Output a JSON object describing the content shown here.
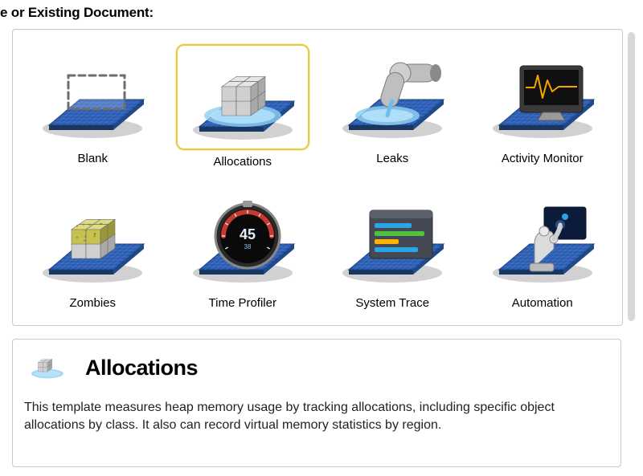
{
  "header": {
    "title_fragment": "e or Existing Document:"
  },
  "templates": [
    {
      "id": "blank",
      "label": "Blank",
      "selected": false,
      "icon": "blank"
    },
    {
      "id": "allocations",
      "label": "Allocations",
      "selected": true,
      "icon": "allocations"
    },
    {
      "id": "leaks",
      "label": "Leaks",
      "selected": false,
      "icon": "leaks"
    },
    {
      "id": "activity-monitor",
      "label": "Activity Monitor",
      "selected": false,
      "icon": "activity-monitor"
    },
    {
      "id": "zombies",
      "label": "Zombies",
      "selected": false,
      "icon": "zombies"
    },
    {
      "id": "time-profiler",
      "label": "Time Profiler",
      "selected": false,
      "icon": "time-profiler"
    },
    {
      "id": "system-trace",
      "label": "System Trace",
      "selected": false,
      "icon": "system-trace"
    },
    {
      "id": "automation",
      "label": "Automation",
      "selected": false,
      "icon": "automation"
    }
  ],
  "detail": {
    "title": "Allocations",
    "description": "This template measures heap memory usage by tracking allocations, including specific object allocations by class. It also can record virtual memory statistics by region.",
    "icon": "allocations"
  },
  "time_profiler_display": "45"
}
